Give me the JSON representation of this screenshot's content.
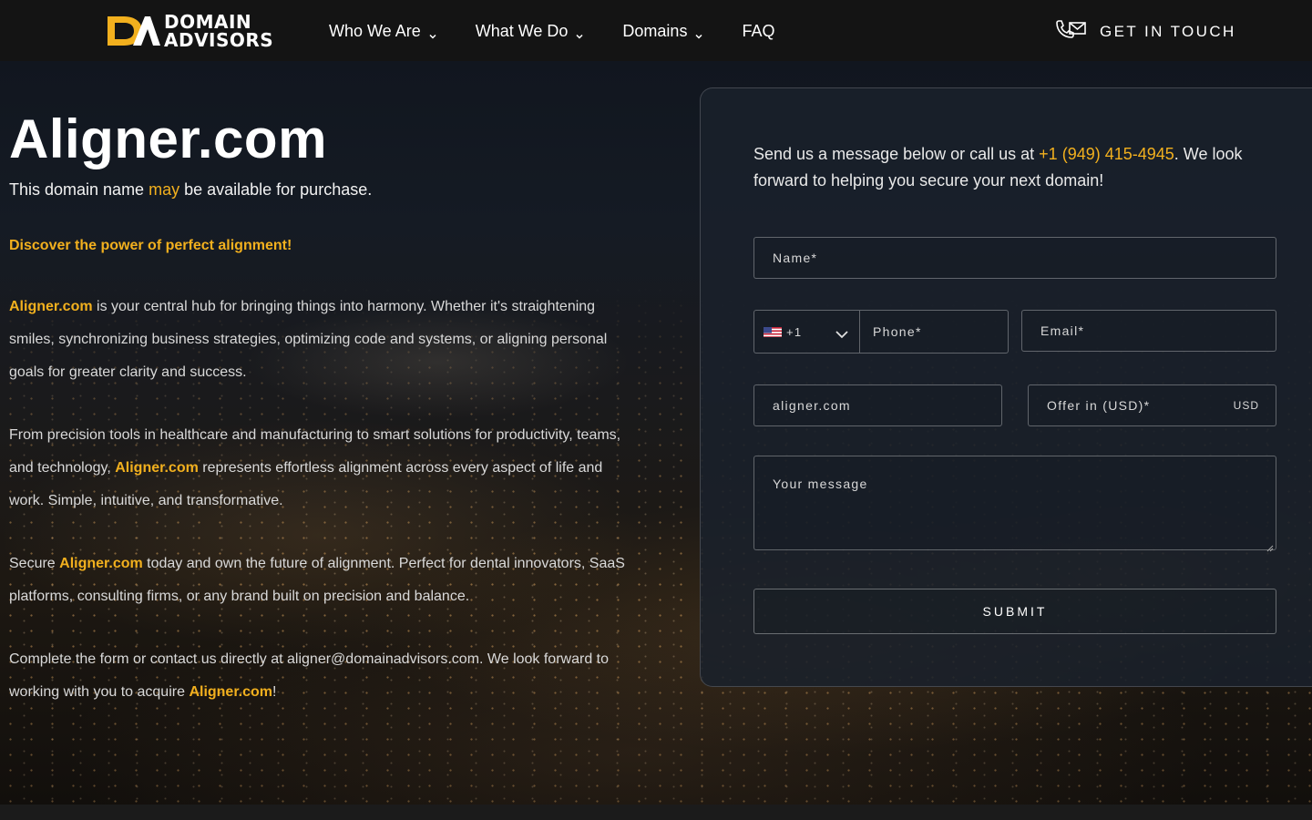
{
  "brand": {
    "logo_line1": "DOMAIN",
    "logo_line2": "ADVISORS",
    "accent_color": "#f2b01e",
    "header_bg": "#141414"
  },
  "nav": {
    "items": [
      {
        "label": "Who We Are",
        "has_dropdown": true
      },
      {
        "label": "What We Do",
        "has_dropdown": true
      },
      {
        "label": "Domains",
        "has_dropdown": true
      },
      {
        "label": "FAQ",
        "has_dropdown": false
      }
    ],
    "contact_label": "GET IN TOUCH",
    "contact_icon": "phone-mail-icon"
  },
  "hero": {
    "domain": "Aligner.com",
    "availability_before": "This domain name ",
    "availability_highlight": "may",
    "availability_after": " be available for purchase.",
    "tagline": "Discover the power of perfect alignment!",
    "p1_domain": "Aligner.com",
    "p1_text": " is your central hub for bringing things into harmony. Whether it's straightening smiles, synchronizing business strategies, optimizing code and systems, or aligning personal goals for greater clarity and success.",
    "p2_before": "From precision tools in healthcare and manufacturing to smart solutions for productivity, teams, and technology, ",
    "p2_domain": "Aligner.com",
    "p2_after": " represents effortless alignment across every aspect of life and work. Simple, intuitive, and transformative.",
    "p3_before": "Secure ",
    "p3_domain": "Aligner.com",
    "p3_after": " today and own the future of alignment. Perfect for dental innovators, SaaS platforms, consulting firms, or any brand built on precision and balance.",
    "p4_before": "Complete the form or contact us directly at aligner@domainadvisors.com. We look forward to working with you to acquire ",
    "p4_domain": "Aligner.com",
    "p4_after": "!"
  },
  "form": {
    "intro_before": "Send us a message below or call us at ",
    "intro_phone": "+1 (949) 415-4945",
    "intro_after": ". We look forward to helping you secure your next domain!",
    "name_placeholder": "Name*",
    "country_code": "+1",
    "country_flag": "us-flag-icon",
    "phone_placeholder": "Phone*",
    "email_placeholder": "Email*",
    "domain_value": "aligner.com",
    "offer_placeholder": "Offer in (USD)*",
    "offer_currency": "USD",
    "message_placeholder": "Your message",
    "submit_label": "SUBMIT"
  }
}
